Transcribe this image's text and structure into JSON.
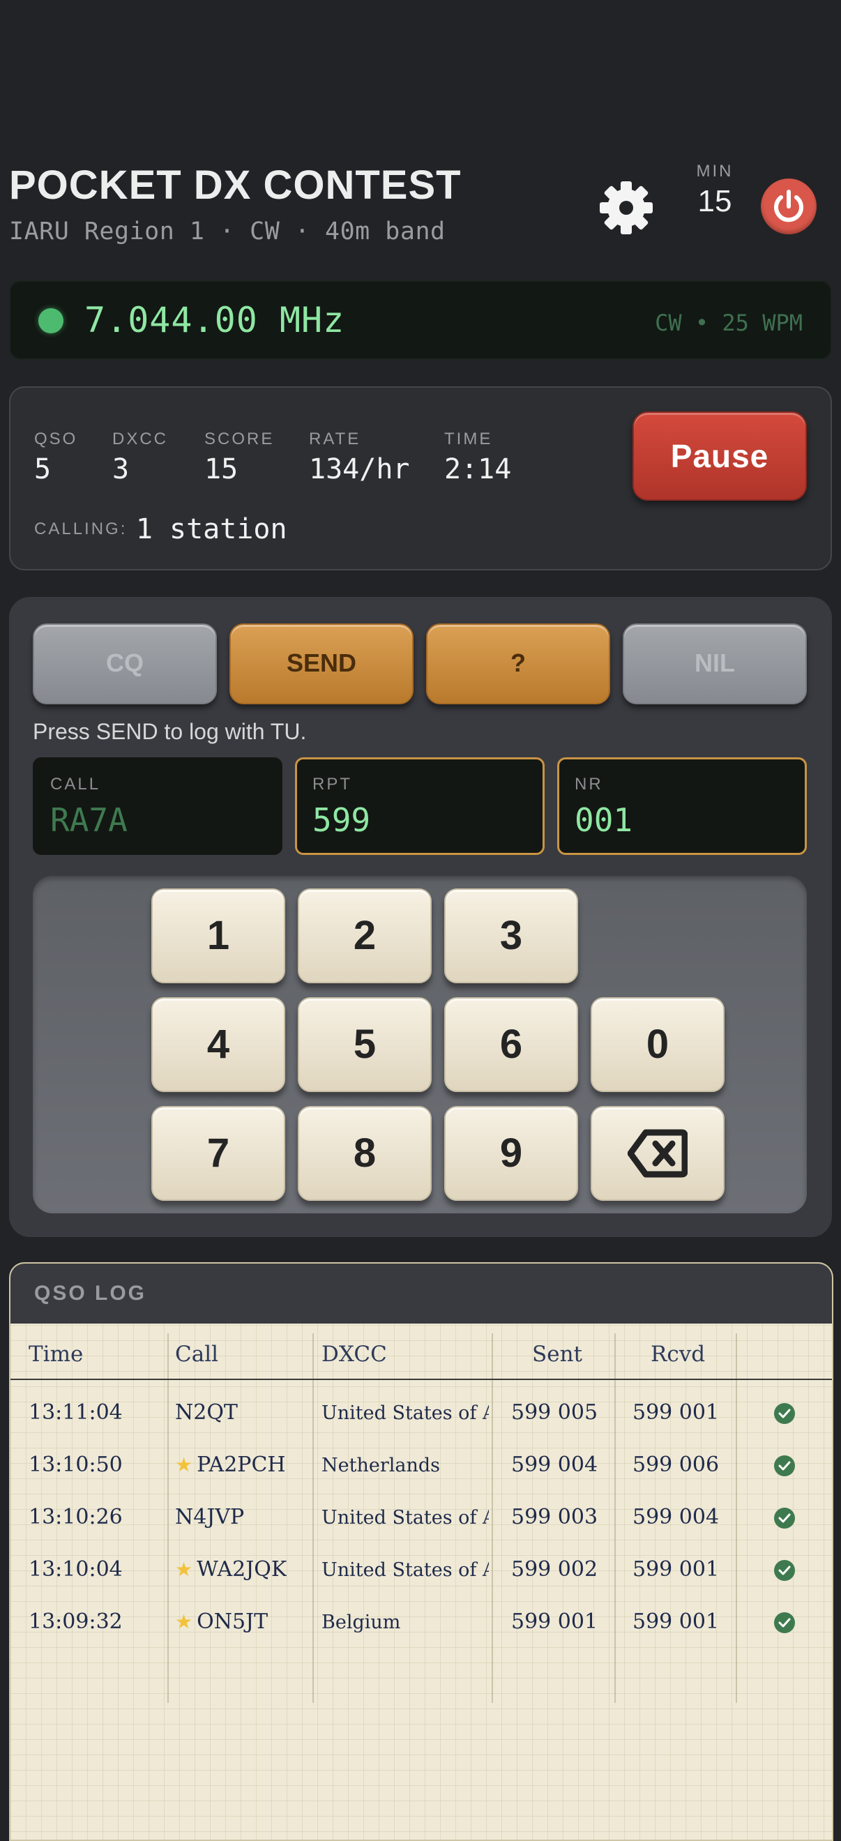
{
  "header": {
    "title": "POCKET DX CONTEST",
    "subtitle": "IARU Region 1 · CW · 40m band",
    "min_label": "MIN",
    "min_value": "15"
  },
  "frequency": {
    "value": "7.044.00 MHz",
    "mode": "CW • 25 WPM"
  },
  "stats": {
    "items": [
      {
        "label": "QSO",
        "value": "5"
      },
      {
        "label": "DXCC",
        "value": "3"
      },
      {
        "label": "SCORE",
        "value": "15"
      },
      {
        "label": "RATE",
        "value": "134/hr"
      },
      {
        "label": "TIME",
        "value": "2:14"
      }
    ],
    "calling_label": "CALLING:",
    "calling_value": "1 station",
    "pause_label": "Pause"
  },
  "keyer": {
    "buttons": [
      "CQ",
      "SEND",
      "?",
      "NIL"
    ],
    "hint": "Press SEND to log with TU.",
    "fields": [
      {
        "label": "CALL",
        "value": "RA7A"
      },
      {
        "label": "RPT",
        "value": "599"
      },
      {
        "label": "NR",
        "value": "001"
      }
    ],
    "keys": [
      "1",
      "2",
      "3",
      "4",
      "5",
      "6",
      "0",
      "7",
      "8",
      "9"
    ],
    "backspace_icon": "backspace-icon"
  },
  "log": {
    "title": "QSO LOG",
    "columns": [
      "Time",
      "Call",
      "DXCC",
      "Sent",
      "Rcvd"
    ],
    "rows": [
      {
        "time": "13:11:04",
        "call": "N2QT",
        "star": false,
        "dxcc": "United States of A...",
        "sent": "599 005",
        "rcvd": "599 001"
      },
      {
        "time": "13:10:50",
        "call": "PA2PCH",
        "star": true,
        "dxcc": "Netherlands",
        "sent": "599 004",
        "rcvd": "599 006"
      },
      {
        "time": "13:10:26",
        "call": "N4JVP",
        "star": false,
        "dxcc": "United States of A...",
        "sent": "599 003",
        "rcvd": "599 004"
      },
      {
        "time": "13:10:04",
        "call": "WA2JQK",
        "star": true,
        "dxcc": "United States of A...",
        "sent": "599 002",
        "rcvd": "599 001"
      },
      {
        "time": "13:09:32",
        "call": "ON5JT",
        "star": true,
        "dxcc": "Belgium",
        "sent": "599 001",
        "rcvd": "599 001"
      }
    ]
  },
  "colors": {
    "accent_green": "#8fe7a3",
    "accent_orange": "#c99444",
    "pause_red": "#c43d30",
    "power_red": "#d9574a"
  }
}
